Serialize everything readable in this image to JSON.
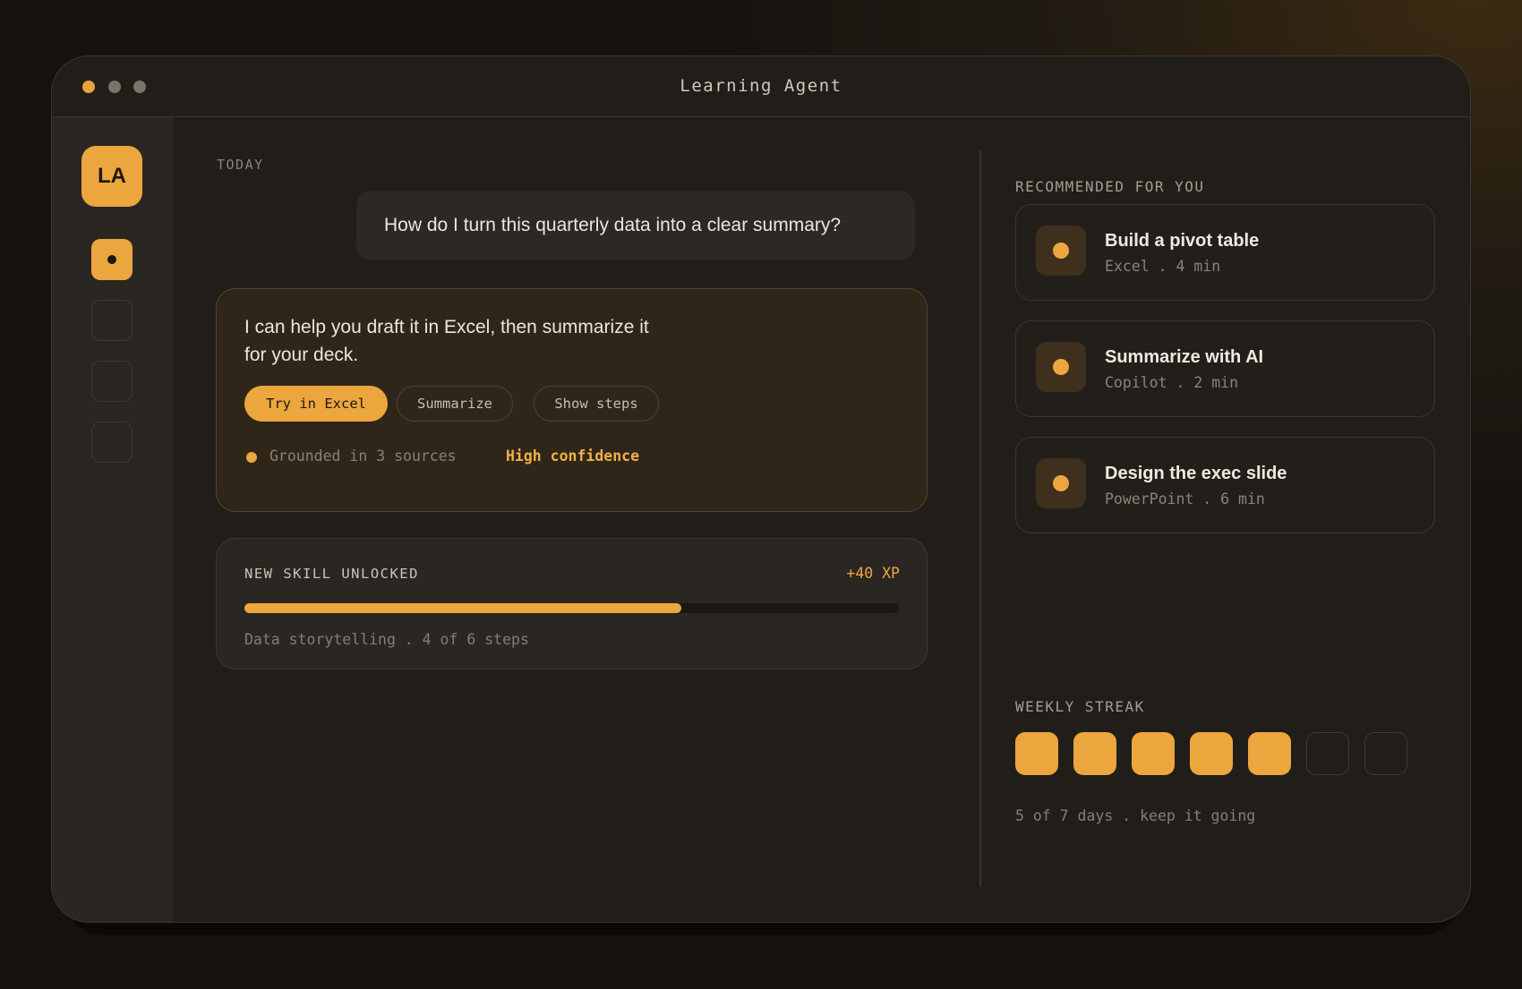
{
  "window": {
    "title": "Learning Agent"
  },
  "sidebar": {
    "avatar_initials": "LA",
    "nav_items": [
      {
        "name": "nav-item-1",
        "active": true
      },
      {
        "name": "nav-item-2",
        "active": false
      },
      {
        "name": "nav-item-3",
        "active": false
      },
      {
        "name": "nav-item-4",
        "active": false
      }
    ]
  },
  "chat": {
    "date_label": "TODAY",
    "user_message": "How do I turn this quarterly data into a clear summary?",
    "agent_message": "I can help you draft it in Excel, then summarize it for your deck.",
    "actions": {
      "primary": "Try in Excel",
      "summarize": "Summarize",
      "show_steps": "Show steps"
    },
    "sources_text": "Grounded in 3 sources",
    "confidence_text": "High confidence"
  },
  "skill": {
    "label": "NEW SKILL UNLOCKED",
    "xp": "+40 XP",
    "progress_fraction": 0.667,
    "subtitle": "Data storytelling . 4 of 6 steps"
  },
  "recommendations": {
    "label": "RECOMMENDED FOR YOU",
    "items": [
      {
        "title": "Build a pivot table",
        "subtitle": "Excel . 4 min"
      },
      {
        "title": "Summarize with AI",
        "subtitle": "Copilot . 2 min"
      },
      {
        "title": "Design the exec slide",
        "subtitle": "PowerPoint . 6 min"
      }
    ]
  },
  "streak": {
    "label": "WEEKLY STREAK",
    "days_completed": 5,
    "days_total": 7,
    "subtitle": "5 of 7 days . keep it going"
  },
  "colors": {
    "accent": "#eca63e",
    "background": "#211e1a",
    "sidebar": "#2a2622"
  }
}
